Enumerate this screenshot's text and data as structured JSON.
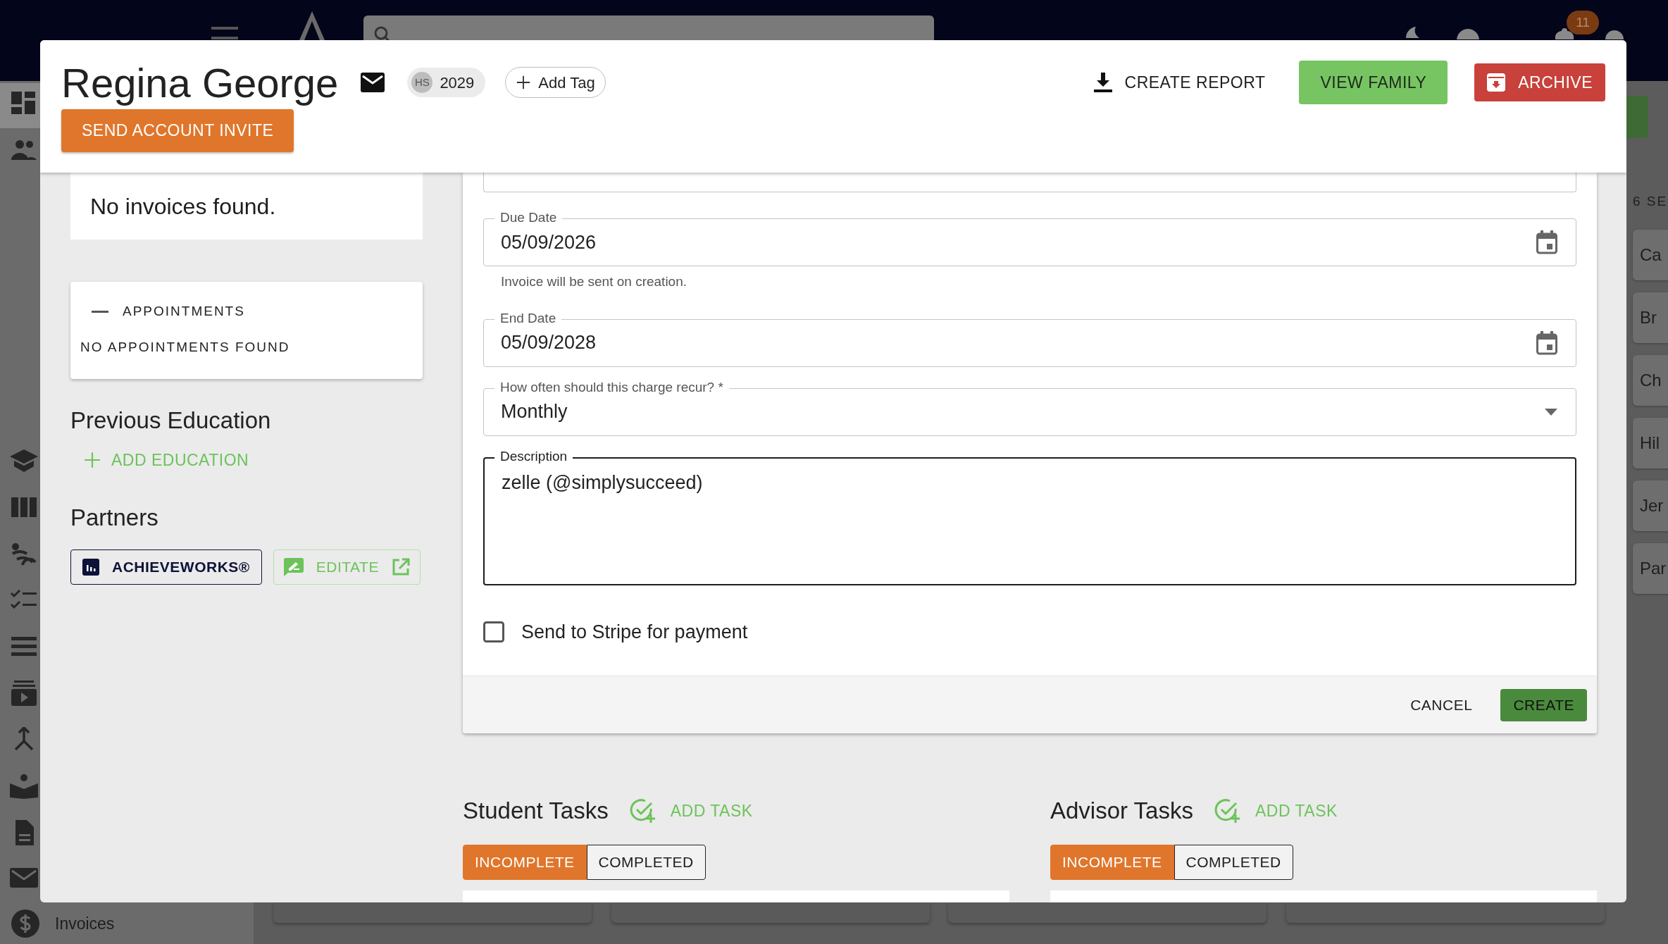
{
  "app_bar": {
    "notification_badge": "11"
  },
  "sidebar": {
    "items": [
      {
        "label": "Invoices"
      }
    ]
  },
  "side_panel": {
    "heading": "6 SE",
    "items": [
      "Ca",
      "Br",
      "Ch",
      "Hil",
      "Jer",
      "Par"
    ]
  },
  "profile": {
    "name": "Regina George",
    "chip": {
      "avatar": "HS",
      "label": "2029"
    },
    "add_tag": "Add Tag",
    "invite_button": "SEND ACCOUNT INVITE",
    "actions": [
      {
        "label": "CREATE REPORT",
        "kind": "report"
      },
      {
        "label": "VIEW FAMILY",
        "kind": "family"
      },
      {
        "label": "ARCHIVE",
        "kind": "archive"
      }
    ]
  },
  "invoices": {
    "empty_text": "No invoices found."
  },
  "appointments": {
    "title": "APPOINTMENTS",
    "expanded": true,
    "empty_text": "NO APPOINTMENTS FOUND"
  },
  "previous_education": {
    "heading": "Previous Education",
    "add_button": "ADD EDUCATION"
  },
  "partners": {
    "heading": "Partners",
    "items": [
      {
        "label": "ACHIEVEWORKS®",
        "kind": "achieveworks"
      },
      {
        "label": "EDITATE",
        "kind": "editate"
      }
    ]
  },
  "charge_form": {
    "fields": [
      {
        "kind": "date",
        "label": "Due Date",
        "value": "05/09/2026",
        "helper": "Invoice will be sent on creation.",
        "focused": false
      },
      {
        "kind": "date",
        "label": "End Date",
        "value": "05/09/2028",
        "focused": false
      },
      {
        "kind": "select",
        "label": "How often should this charge recur? *",
        "value": "Monthly",
        "focused": false
      },
      {
        "kind": "textarea",
        "label": "Description",
        "value": "zelle (@simplysucceed)",
        "focused": true
      }
    ],
    "stripe_checkbox": {
      "label": "Send to Stripe for payment",
      "checked": false
    },
    "buttons": [
      {
        "label": "CANCEL",
        "kind": "text"
      },
      {
        "label": "CREATE",
        "kind": "primary"
      }
    ]
  },
  "task_panels": [
    {
      "heading": "Student Tasks",
      "add_button": "ADD TASK",
      "tabs": [
        {
          "label": "INCOMPLETE",
          "selected": true
        },
        {
          "label": "COMPLETED",
          "selected": false
        }
      ]
    },
    {
      "heading": "Advisor Tasks",
      "add_button": "ADD TASK",
      "tabs": [
        {
          "label": "INCOMPLETE",
          "selected": true
        },
        {
          "label": "COMPLETED",
          "selected": false
        }
      ]
    }
  ]
}
